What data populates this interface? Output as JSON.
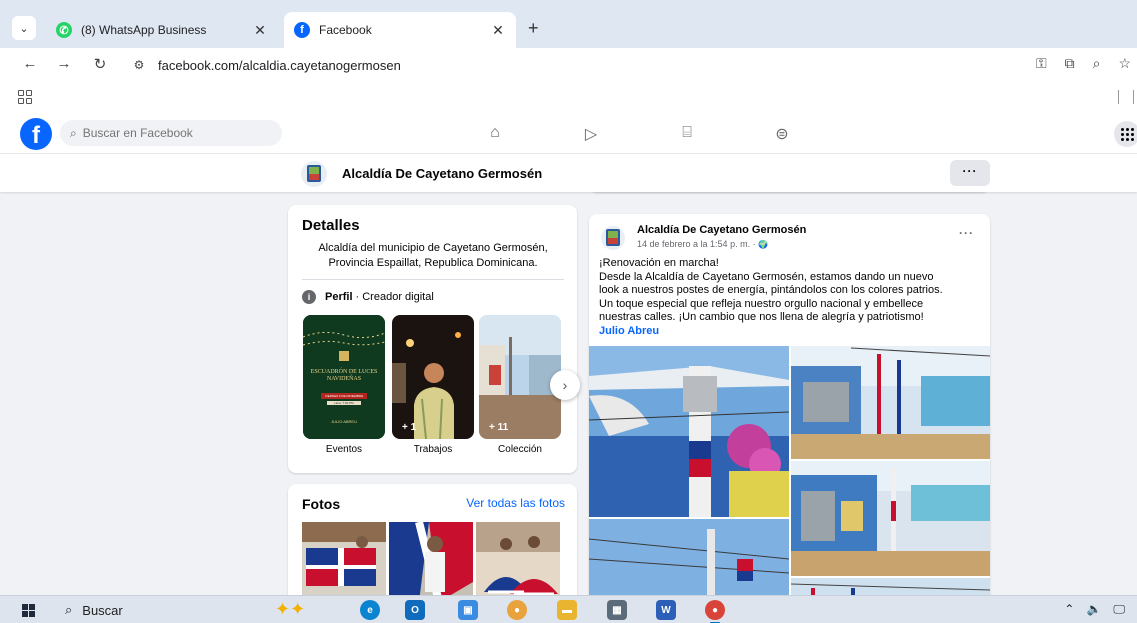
{
  "browser": {
    "tabs": [
      {
        "title": "(8) WhatsApp Business",
        "favicon": "whatsapp-icon",
        "active": false
      },
      {
        "title": "Facebook",
        "favicon": "facebook-icon",
        "active": true
      }
    ],
    "tab_list_glyph": "⌄",
    "close_glyph": "✕",
    "new_tab_glyph": "+",
    "url": "facebook.com/alcaldia.cayetanogermosen"
  },
  "facebook": {
    "logo_glyph": "f",
    "search_placeholder": "Buscar en Facebook",
    "page_name": "Alcaldía De Cayetano Germosén",
    "more_glyph": "···",
    "details": {
      "title": "Detalles",
      "bio": "Alcaldía del municipio de Cayetano Germosén, Provincia Espaillat, Republica Dominicana.",
      "profile_label": "Perfil",
      "profile_value": " · Creador digital",
      "tiles": [
        {
          "label": "Eventos",
          "count": "",
          "flyer_title": "ESCUADRÓN DE LUCES NAVIDEÑAS",
          "flyer_date": "VIERNES 6 DE DICIEMBRE",
          "flyer_time": "Hora: 7:00 PM",
          "flyer_sign": "JULIO ABREU"
        },
        {
          "label": "Trabajos",
          "count": "+ 1"
        },
        {
          "label": "Colección",
          "count": "+ 11"
        }
      ]
    },
    "photos": {
      "title": "Fotos",
      "see_all": "Ver todas las fotos"
    },
    "post": {
      "author": "Alcaldía De Cayetano Germosén",
      "date": "14 de febrero a la 1:54 p. m. · ",
      "privacy_glyph": "🌍",
      "lines": [
        "¡Renovación en marcha!",
        "Desde la Alcaldía de Cayetano Germosén, estamos dando un nuevo",
        "look a nuestros postes de energía, pintándolos con los colores patrios.",
        "Un toque especial que refleja nuestro orgullo nacional y embellece",
        "nuestras calles. ¡Un cambio que nos llena de alegría y patriotismo!"
      ],
      "tag": "Julio Abreu"
    }
  },
  "taskbar": {
    "search_label": "Buscar",
    "apps": [
      {
        "name": "edge-icon",
        "color": "#0a84d0",
        "glyph": "e"
      },
      {
        "name": "outlook-icon",
        "color": "#0f6cbd",
        "glyph": "O"
      },
      {
        "name": "photos-icon",
        "color": "#3b8be0",
        "glyph": "▣"
      },
      {
        "name": "chrome-icon",
        "color": "#e8a33d",
        "glyph": "●"
      },
      {
        "name": "file-explorer-icon",
        "color": "#e9b531",
        "glyph": "▬"
      },
      {
        "name": "calculator-icon",
        "color": "#5c6b7a",
        "glyph": "▦"
      },
      {
        "name": "word-icon",
        "color": "#2b5fb8",
        "glyph": "W"
      },
      {
        "name": "chrome-profile-icon",
        "color": "#d9443a",
        "glyph": "●"
      }
    ],
    "tray": [
      "⌃",
      "🔈",
      "🖵"
    ]
  }
}
